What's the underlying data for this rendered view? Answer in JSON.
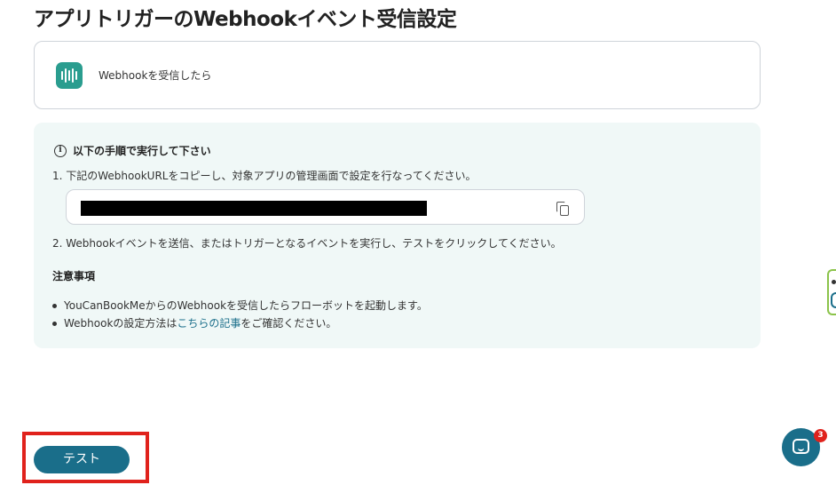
{
  "page_title": "アプリトリガーのWebhookイベント受信設定",
  "trigger": {
    "icon": "webhook-logo-icon",
    "label": "Webhookを受信したら",
    "logo_color": "#2a9d8f"
  },
  "instructions": {
    "heading": "以下の手順で実行して下さい",
    "step1": "1. 下記のWebhookURLをコピーし、対象アプリの管理画面で設定を行なってください。",
    "url_value": "",
    "step2": "2. Webhookイベントを送信、またはトリガーとなるイベントを実行し、テストをクリックしてください。"
  },
  "notes": {
    "heading": "注意事項",
    "item1": "YouCanBookMeからのWebhookを受信したらフローボットを起動します。",
    "item2_prefix": "Webhookの設定方法は",
    "item2_link": "こちらの記事",
    "item2_suffix": "をご確認ください。"
  },
  "test_button_label": "テスト",
  "chat_badge_count": "3",
  "colors": {
    "accent": "#1a6e8a",
    "panel_bg": "#f0f8f7",
    "highlight": "#e0221c"
  }
}
